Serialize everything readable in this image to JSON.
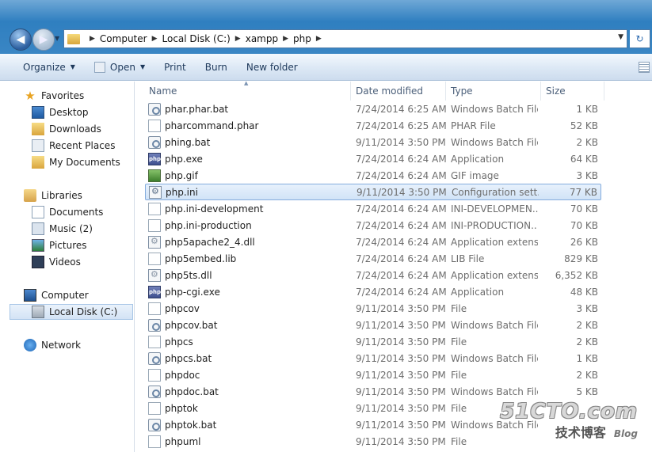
{
  "address": {
    "breadcrumb": [
      "Computer",
      "Local Disk (C:)",
      "xampp",
      "php"
    ]
  },
  "toolbar": {
    "organize": "Organize",
    "open": "Open",
    "print": "Print",
    "burn": "Burn",
    "new_folder": "New folder"
  },
  "navpane": {
    "favorites": "Favorites",
    "desktop": "Desktop",
    "downloads": "Downloads",
    "recent_places": "Recent Places",
    "my_documents": "My Documents",
    "libraries": "Libraries",
    "documents": "Documents",
    "music": "Music (2)",
    "pictures": "Pictures",
    "videos": "Videos",
    "computer": "Computer",
    "local_disk": "Local Disk (C:)",
    "network": "Network"
  },
  "columns": {
    "name": "Name",
    "date": "Date modified",
    "type": "Type",
    "size": "Size"
  },
  "files": [
    {
      "name": "phar.phar.bat",
      "date": "7/24/2014 6:25 AM",
      "type": "Windows Batch File",
      "size": "1 KB",
      "icon": "bat"
    },
    {
      "name": "pharcommand.phar",
      "date": "7/24/2014 6:25 AM",
      "type": "PHAR File",
      "size": "52 KB",
      "icon": "file"
    },
    {
      "name": "phing.bat",
      "date": "9/11/2014 3:50 PM",
      "type": "Windows Batch File",
      "size": "2 KB",
      "icon": "bat"
    },
    {
      "name": "php.exe",
      "date": "7/24/2014 6:24 AM",
      "type": "Application",
      "size": "64 KB",
      "icon": "php"
    },
    {
      "name": "php.gif",
      "date": "7/24/2014 6:24 AM",
      "type": "GIF image",
      "size": "3 KB",
      "icon": "gif"
    },
    {
      "name": "php.ini",
      "date": "9/11/2014 3:50 PM",
      "type": "Configuration sett...",
      "size": "77 KB",
      "icon": "ini",
      "selected": true
    },
    {
      "name": "php.ini-development",
      "date": "7/24/2014 6:24 AM",
      "type": "INI-DEVELOPMEN...",
      "size": "70 KB",
      "icon": "file"
    },
    {
      "name": "php.ini-production",
      "date": "7/24/2014 6:24 AM",
      "type": "INI-PRODUCTION...",
      "size": "70 KB",
      "icon": "file"
    },
    {
      "name": "php5apache2_4.dll",
      "date": "7/24/2014 6:24 AM",
      "type": "Application extens...",
      "size": "26 KB",
      "icon": "dll"
    },
    {
      "name": "php5embed.lib",
      "date": "7/24/2014 6:24 AM",
      "type": "LIB File",
      "size": "829 KB",
      "icon": "file"
    },
    {
      "name": "php5ts.dll",
      "date": "7/24/2014 6:24 AM",
      "type": "Application extens...",
      "size": "6,352 KB",
      "icon": "dll"
    },
    {
      "name": "php-cgi.exe",
      "date": "7/24/2014 6:24 AM",
      "type": "Application",
      "size": "48 KB",
      "icon": "php"
    },
    {
      "name": "phpcov",
      "date": "9/11/2014 3:50 PM",
      "type": "File",
      "size": "3 KB",
      "icon": "file"
    },
    {
      "name": "phpcov.bat",
      "date": "9/11/2014 3:50 PM",
      "type": "Windows Batch File",
      "size": "2 KB",
      "icon": "bat"
    },
    {
      "name": "phpcs",
      "date": "9/11/2014 3:50 PM",
      "type": "File",
      "size": "2 KB",
      "icon": "file"
    },
    {
      "name": "phpcs.bat",
      "date": "9/11/2014 3:50 PM",
      "type": "Windows Batch File",
      "size": "1 KB",
      "icon": "bat"
    },
    {
      "name": "phpdoc",
      "date": "9/11/2014 3:50 PM",
      "type": "File",
      "size": "2 KB",
      "icon": "file"
    },
    {
      "name": "phpdoc.bat",
      "date": "9/11/2014 3:50 PM",
      "type": "Windows Batch File",
      "size": "5 KB",
      "icon": "bat"
    },
    {
      "name": "phptok",
      "date": "9/11/2014 3:50 PM",
      "type": "File",
      "size": "",
      "icon": "file"
    },
    {
      "name": "phptok.bat",
      "date": "9/11/2014 3:50 PM",
      "type": "Windows Batch File",
      "size": "",
      "icon": "bat"
    },
    {
      "name": "phpuml",
      "date": "9/11/2014 3:50 PM",
      "type": "File",
      "size": "",
      "icon": "file"
    }
  ],
  "watermark": {
    "logo": "51CTO.com",
    "sub": "技术博客",
    "blog": "Blog"
  }
}
